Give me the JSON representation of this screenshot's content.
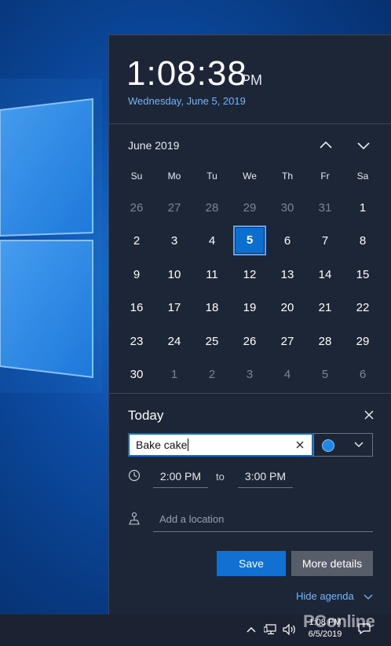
{
  "clock": {
    "time": "1:08:38",
    "ampm": "PM",
    "date": "Wednesday, June 5, 2019"
  },
  "calendar": {
    "month_label": "June 2019",
    "weekdays": [
      "Su",
      "Mo",
      "Tu",
      "We",
      "Th",
      "Fr",
      "Sa"
    ],
    "weeks": [
      [
        "26",
        "27",
        "28",
        "29",
        "30",
        "31",
        "1"
      ],
      [
        "2",
        "3",
        "4",
        "5",
        "6",
        "7",
        "8"
      ],
      [
        "9",
        "10",
        "11",
        "12",
        "13",
        "14",
        "15"
      ],
      [
        "16",
        "17",
        "18",
        "19",
        "20",
        "21",
        "22"
      ],
      [
        "23",
        "24",
        "25",
        "26",
        "27",
        "28",
        "29"
      ],
      [
        "30",
        "1",
        "2",
        "3",
        "4",
        "5",
        "6"
      ]
    ],
    "selected_day": "5"
  },
  "agenda": {
    "title": "Today",
    "event_title": "Bake cake",
    "event_color": "#1e88e5",
    "start_time": "2:00 PM",
    "to_label": "to",
    "end_time": "3:00 PM",
    "location_placeholder": "Add a location",
    "save_label": "Save",
    "more_details_label": "More details",
    "hide_agenda_label": "Hide agenda"
  },
  "taskbar": {
    "time": "1:08 PM",
    "date": "6/5/2019"
  },
  "watermark": "PConline",
  "colors": {
    "accent": "#1170d1",
    "flyout_bg": "#1d2637",
    "link": "#7ab3f0"
  }
}
